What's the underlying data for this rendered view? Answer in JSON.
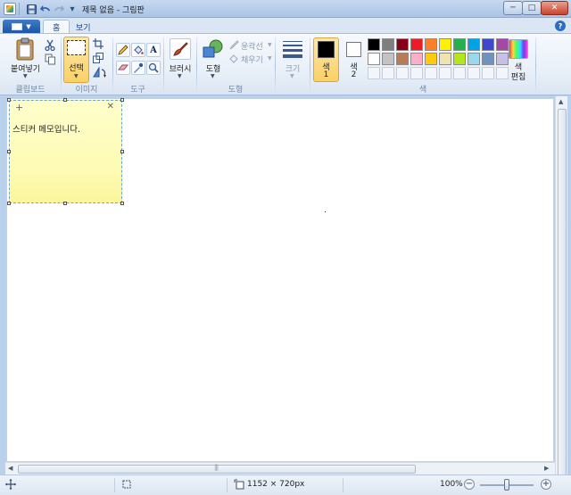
{
  "window": {
    "title": "제목 없음 - 그림판",
    "qa_dropdown": "▾",
    "controls": {
      "minimize": "─",
      "maximize": "□",
      "close": "✕"
    }
  },
  "tabs": [
    {
      "label": "홈",
      "active": true
    },
    {
      "label": "보기",
      "active": false
    }
  ],
  "help_label": "?",
  "ribbon": {
    "clipboard": {
      "group_label": "클립보드",
      "paste_label": "붙여넣기"
    },
    "image": {
      "group_label": "이미지",
      "select_label": "선택"
    },
    "tools": {
      "group_label": "도구"
    },
    "brushes": {
      "label": "브러시"
    },
    "shapes": {
      "group_label": "도형",
      "shapes_label": "도형",
      "outline_label": "윤곽선",
      "fill_label": "채우기"
    },
    "size": {
      "label": "크기"
    },
    "colors": {
      "group_label": "색",
      "color1_label": [
        "색",
        "1"
      ],
      "color2_label": [
        "색",
        "2"
      ],
      "edit_label": [
        "색",
        "편집"
      ],
      "color1": "#000000",
      "color2": "#ffffff",
      "palette_row1": [
        "#000000",
        "#7f7f7f",
        "#880015",
        "#ed1c24",
        "#ff7f27",
        "#fff200",
        "#22b14c",
        "#00a2e8",
        "#3f48cc",
        "#a349a4"
      ],
      "palette_row2": [
        "#ffffff",
        "#c3c3c3",
        "#b97a57",
        "#ffaec9",
        "#ffc90e",
        "#efe4b0",
        "#b5e61d",
        "#99d9ea",
        "#7092be",
        "#c8bfe7"
      ],
      "palette_row3_count": 10
    }
  },
  "sticky_note": {
    "add": "+",
    "close": "✕",
    "text": "스티커 메모입니다."
  },
  "statusbar": {
    "image_size": "1152 × 720px",
    "zoom_level": "100%",
    "zoom_out": "−",
    "zoom_in": "+"
  }
}
